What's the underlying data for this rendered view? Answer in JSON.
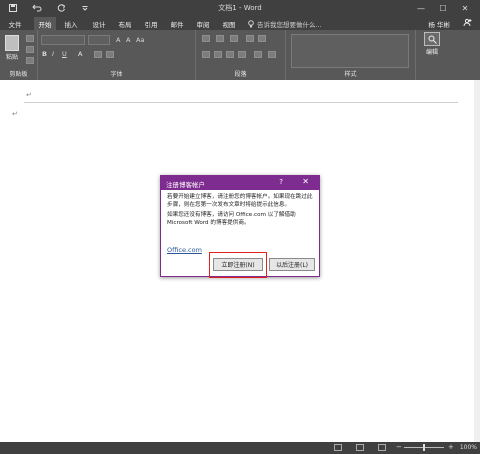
{
  "window": {
    "title": "文档1 - Word",
    "controls": [
      "—",
      "☐",
      "✕"
    ]
  },
  "quick_access": {
    "save_icon": "save-icon",
    "undo_icon": "undo-icon",
    "redo_icon": "redo-icon",
    "customize_icon": "dropdown-icon"
  },
  "tabs": [
    {
      "label": "文件"
    },
    {
      "label": "开始"
    },
    {
      "label": "插入"
    },
    {
      "label": "设计"
    },
    {
      "label": "布局"
    },
    {
      "label": "引用"
    },
    {
      "label": "邮件"
    },
    {
      "label": "审阅"
    },
    {
      "label": "视图"
    }
  ],
  "tell_me": "告诉我您想要做什么...",
  "user": "杨 华彬",
  "ribbon": {
    "paste_label": "粘贴",
    "groups": {
      "clipboard": "剪贴板",
      "font": "字体",
      "paragraph": "段落",
      "styles": "样式",
      "editing": "编辑"
    },
    "font_buttons": [
      "B",
      "I",
      "U",
      "A"
    ]
  },
  "document": {
    "paragraph_marks": [
      "↵",
      "↵"
    ]
  },
  "dialog": {
    "title": "注册博客帐户",
    "help": "?",
    "close": "✕",
    "text1": "若要开始建立博客，请注册您的博客帐户。如果现在跳过此步骤，则在您第一次发布文章时将给提示此信息。",
    "text2": "如果您还没有博客，请访问 Office.com 以了解借助 Microsoft Word 的博客提供商。",
    "link": "Office.com",
    "register_button": "立即注册(N)",
    "later_button": "以后注册(L)"
  },
  "status": {
    "zoom_minus": "−",
    "zoom_plus": "+",
    "zoom": "100%"
  },
  "colors": {
    "dialog_title_bg": "#7e2c90",
    "highlight": "#e2231a",
    "chrome": "#404040"
  }
}
